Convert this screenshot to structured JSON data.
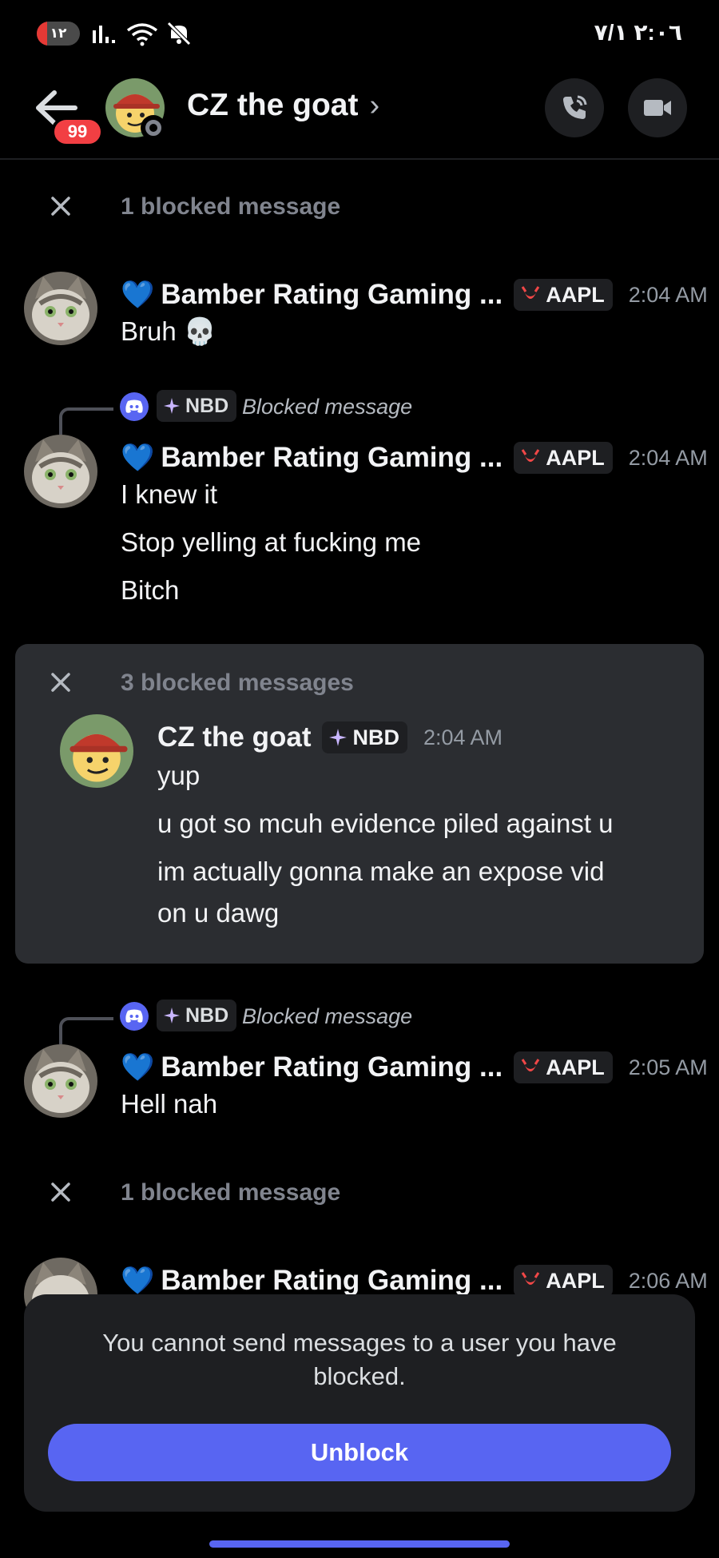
{
  "status_bar": {
    "battery": "١٢",
    "clock": "٢:٠٦  ٧/١",
    "signal_icon": "signal-bars-icon",
    "wifi_icon": "wifi-icon",
    "mute_icon": "muted-icon"
  },
  "header": {
    "unread_badge": "99",
    "title": "CZ the goat",
    "chevron": "›",
    "call_icon": "phone-call-icon",
    "video_icon": "video-camera-icon"
  },
  "feed": {
    "blocked_1": "1 blocked message",
    "msg1": {
      "heart": "💙",
      "author": "Bamber Rating Gaming ...",
      "tag": "AAPL",
      "time": "2:04 AM",
      "lines": [
        "Bruh 💀"
      ]
    },
    "reply1": {
      "tag": "NBD",
      "text": "Blocked message"
    },
    "msg2": {
      "heart": "💙",
      "author": "Bamber Rating Gaming ...",
      "tag": "AAPL",
      "time": "2:04 AM",
      "lines": [
        "I knew it",
        "Stop yelling at fucking me",
        "Bitch"
      ]
    },
    "blocked_panel": {
      "label": "3 blocked messages",
      "author": "CZ the goat",
      "tag": "NBD",
      "time": "2:04 AM",
      "lines": [
        "yup",
        "u got so mcuh evidence piled against u",
        "im actually gonna make an expose vid",
        "on u dawg"
      ]
    },
    "reply2": {
      "tag": "NBD",
      "text": "Blocked message"
    },
    "msg3": {
      "heart": "💙",
      "author": "Bamber Rating Gaming ...",
      "tag": "AAPL",
      "time": "2:05 AM",
      "lines": [
        "Hell nah"
      ]
    },
    "blocked_2": "1 blocked message",
    "msg4": {
      "heart": "💙",
      "author": "Bamber Rating Gaming ...",
      "tag": "AAPL",
      "time": "2:06 AM"
    }
  },
  "footer": {
    "notice": "You cannot send messages to a user you have blocked.",
    "button": "Unblock"
  },
  "colors": {
    "background": "#000000",
    "panel": "#2b2d31",
    "blurple": "#5865f2",
    "badge_red": "#f23f43",
    "muted_text": "#80848e"
  }
}
